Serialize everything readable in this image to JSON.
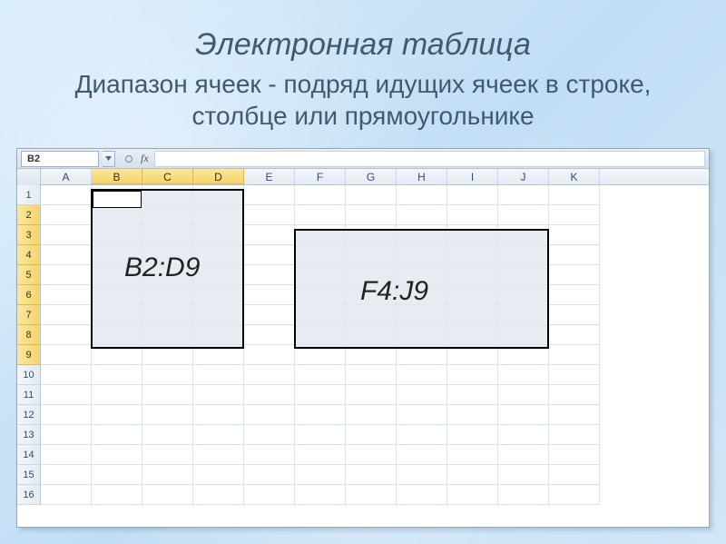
{
  "header": {
    "title": "Электронная таблица",
    "subtitle": "Диапазон ячеек - подряд идущих ячеек в строке, столбце или прямоугольнике"
  },
  "toolbar": {
    "namebox_value": "B2",
    "fx_label": "fx",
    "formula_value": ""
  },
  "columns": [
    "A",
    "B",
    "C",
    "D",
    "E",
    "F",
    "G",
    "H",
    "I",
    "J",
    "K"
  ],
  "selected_columns": [
    "B",
    "C",
    "D"
  ],
  "rows": [
    "1",
    "2",
    "3",
    "4",
    "5",
    "6",
    "7",
    "8",
    "9",
    "10",
    "11",
    "12",
    "13",
    "14",
    "15",
    "16"
  ],
  "selected_rows": [
    "2",
    "3",
    "4",
    "5",
    "6",
    "7",
    "8",
    "9"
  ],
  "ranges": {
    "range1_label": "B2:D9",
    "range2_label": "F4:J9"
  }
}
